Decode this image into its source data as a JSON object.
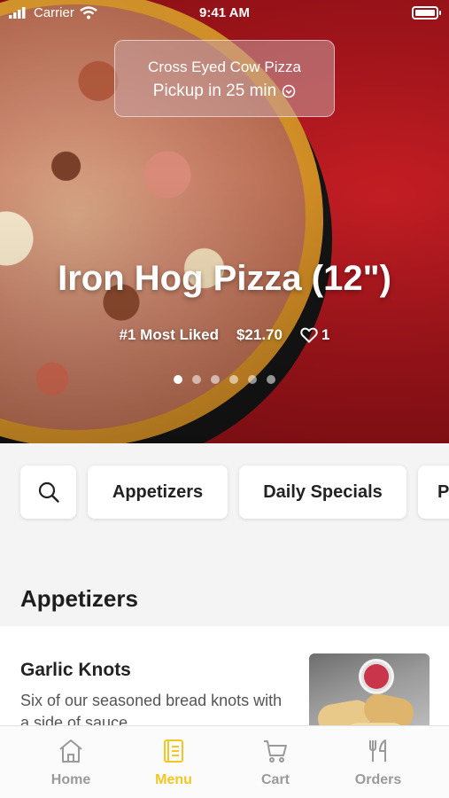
{
  "status_bar": {
    "carrier": "Carrier",
    "time": "9:41 AM"
  },
  "pickup": {
    "restaurant": "Cross Eyed Cow Pizza",
    "time_label": "Pickup in 25 min"
  },
  "featured": {
    "title": "Iron Hog Pizza (12\")",
    "rank": "#1 Most Liked",
    "price": "$21.70",
    "likes": "1",
    "carousel_count": 6,
    "carousel_active": 0
  },
  "categories": [
    "Appetizers",
    "Daily Specials",
    "P"
  ],
  "section": {
    "title": "Appetizers"
  },
  "menu_items": [
    {
      "name": "Garlic Knots",
      "description": "Six of our seasoned bread knots with a side of sauce"
    }
  ],
  "tabs": [
    {
      "label": "Home",
      "icon": "home-icon",
      "active": false
    },
    {
      "label": "Menu",
      "icon": "menu-book-icon",
      "active": true
    },
    {
      "label": "Cart",
      "icon": "cart-icon",
      "active": false
    },
    {
      "label": "Orders",
      "icon": "fork-knife-icon",
      "active": false
    }
  ],
  "colors": {
    "accent": "#f3c623",
    "hero_background": "#a5151b",
    "inactive_tab": "#9a9a9a"
  }
}
